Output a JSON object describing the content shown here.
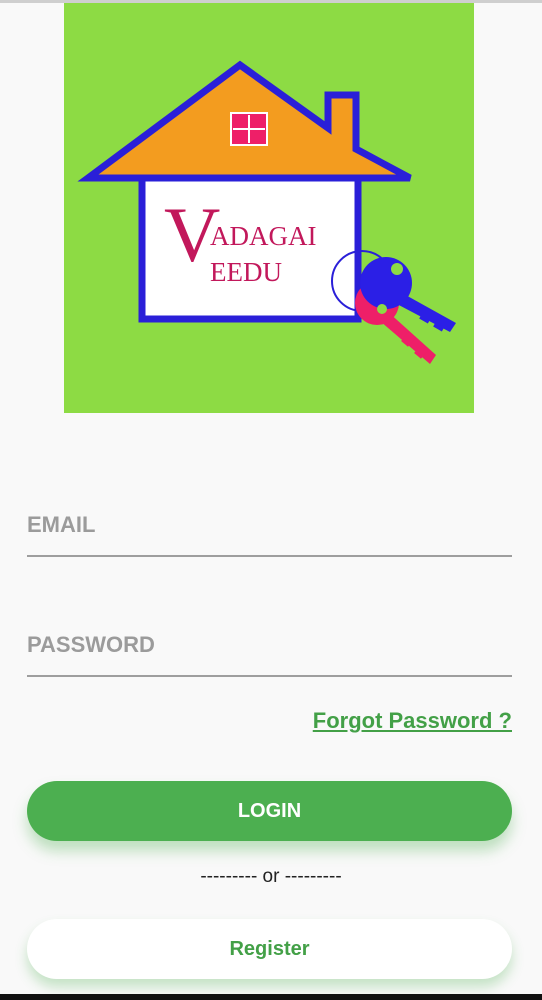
{
  "logo": {
    "line1_initial": "V",
    "line1_rest": "ADAGAI",
    "line2_initial": "V",
    "line2_rest": "EEDU",
    "colors": {
      "background": "#8ddb44",
      "roof": "#f39c1f",
      "house_outline": "#2a1fd8",
      "text": "#c2185b",
      "key_blue": "#2b1fe6",
      "key_pink": "#ee1f68"
    }
  },
  "form": {
    "email_placeholder": "EMAIL",
    "password_placeholder": "PASSWORD",
    "forgot_label": "Forgot Password ?",
    "login_label": "LOGIN",
    "separator": "--------- or ---------",
    "register_label": "Register"
  },
  "colors": {
    "accent": "#4caf50",
    "page_background": "#f9f9f9"
  }
}
